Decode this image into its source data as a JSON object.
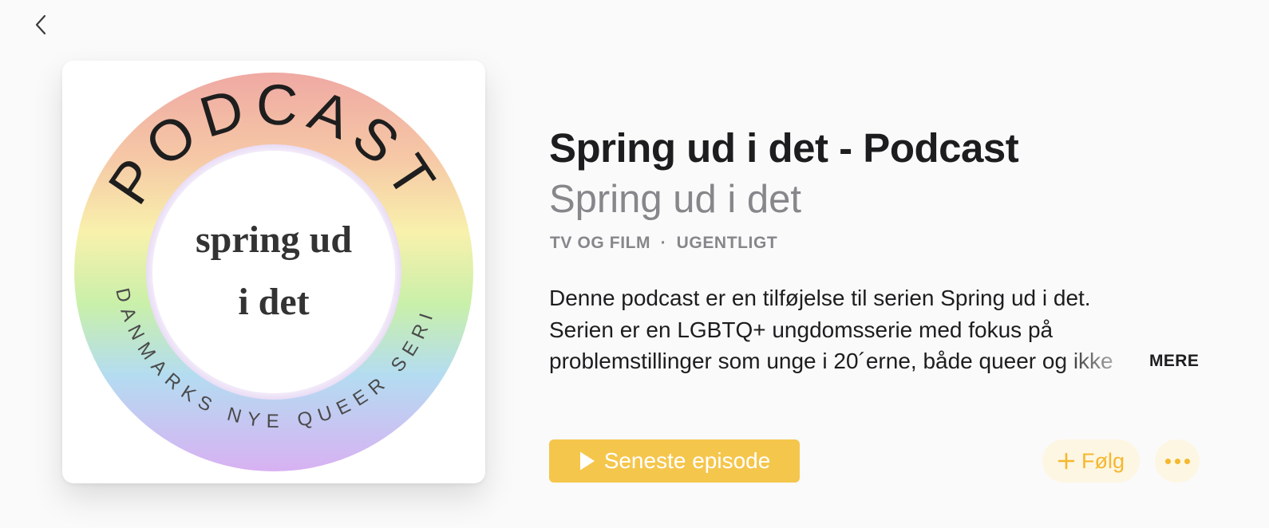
{
  "navigation": {
    "back_icon": "chevron-left-icon"
  },
  "artwork": {
    "ring_top_text": "PODCAST",
    "ring_bottom_text": "DANMARKS NYE QUEER SERIE",
    "center_line_1": "spring ud",
    "center_line_2": "i det"
  },
  "podcast": {
    "title": "Spring ud i det - Podcast",
    "author": "Spring ud i det",
    "category": "TV OG FILM",
    "separator": "·",
    "frequency": "UGENTLIGT",
    "description_lines": [
      "Denne podcast er en tilføjelse til serien Spring ud i det.",
      "Serien er en LGBTQ+ ungdomsserie med fokus på",
      "problemstillinger som unge i 20´erne, både queer og ikke"
    ],
    "more_label": "MERE"
  },
  "actions": {
    "play_label": "Seneste episode",
    "play_icon": "play-icon",
    "follow_label": "Følg",
    "follow_icon": "plus-icon",
    "more_icon": "ellipsis-icon"
  },
  "colors": {
    "accent": "#f5c64c",
    "accent_text": "#f5b82e",
    "secondary_text": "#86868b",
    "primary_text": "#1d1d1f",
    "background": "#fafafa"
  }
}
